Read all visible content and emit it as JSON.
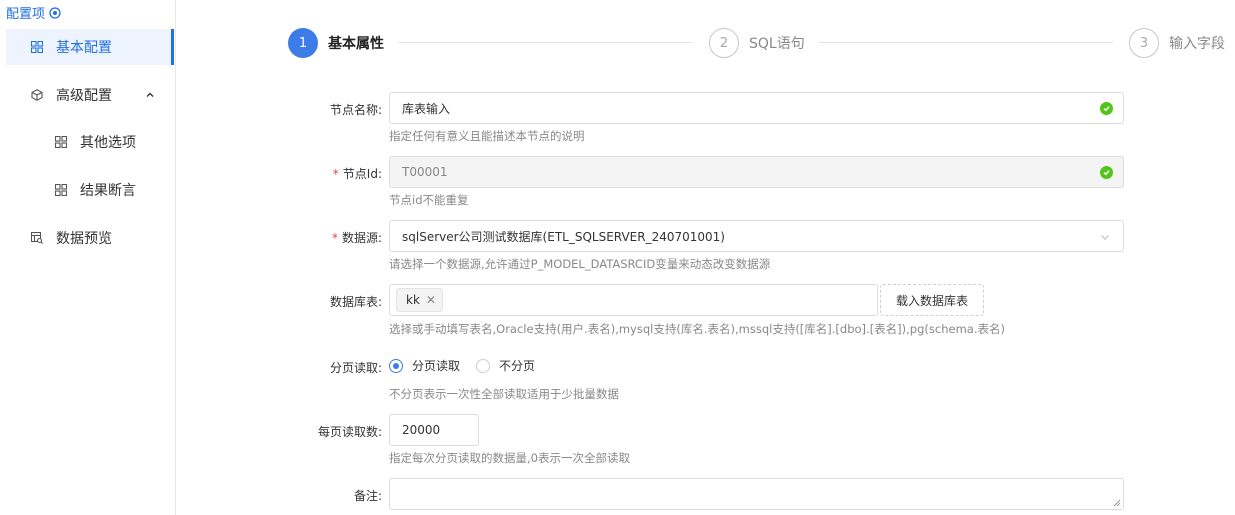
{
  "sidebar": {
    "title": "配置项",
    "items": [
      {
        "label": "基本配置",
        "icon": "grid-icon"
      },
      {
        "label": "高级配置",
        "icon": "cube-icon"
      },
      {
        "label": "其他选项",
        "icon": "grid-icon"
      },
      {
        "label": "结果断言",
        "icon": "grid-icon"
      },
      {
        "label": "数据预览",
        "icon": "table-search-icon"
      }
    ]
  },
  "steps": [
    {
      "num": "1",
      "label": "基本属性"
    },
    {
      "num": "2",
      "label": "SQL语句"
    },
    {
      "num": "3",
      "label": "输入字段"
    }
  ],
  "form": {
    "node_name": {
      "label": "节点名称:",
      "value": "库表输入",
      "hint": "指定任何有意义且能描述本节点的说明"
    },
    "node_id": {
      "label": "节点Id:",
      "value": "T00001",
      "hint": "节点id不能重复"
    },
    "datasource": {
      "label": "数据源:",
      "value": "sqlServer公司测试数据库(ETL_SQLSERVER_240701001)",
      "hint": "请选择一个数据源,允许通过P_MODEL_DATASRCID变量来动态改变数据源"
    },
    "db_table": {
      "label": "数据库表:",
      "tag": "kk",
      "button": "载入数据库表",
      "hint": "选择或手动填写表名,Oracle支持(用户.表名),mysql支持(库名.表名),mssql支持([库名].[dbo].[表名]),pg(schema.表名)"
    },
    "paging": {
      "label": "分页读取:",
      "option_on": "分页读取",
      "option_off": "不分页",
      "hint": "不分页表示一次性全部读取适用于少批量数据"
    },
    "page_size": {
      "label": "每页读取数:",
      "value": "20000",
      "hint": "指定每次分页读取的数据量,0表示一次全部读取"
    },
    "remark": {
      "label": "备注:"
    }
  },
  "required_mark": "*",
  "colors": {
    "accent": "#3c7be8",
    "ok": "#52c41a",
    "required": "#e54545"
  }
}
